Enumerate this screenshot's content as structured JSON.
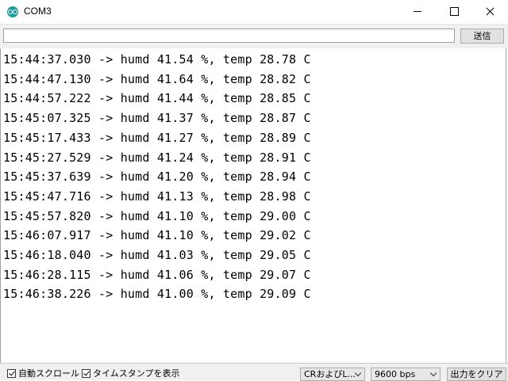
{
  "window": {
    "title": "COM3",
    "icon": "arduino-icon"
  },
  "send": {
    "input_value": "",
    "button_label": "送信"
  },
  "log": [
    "15:44:37.030 -> humd 41.54 %, temp 28.78 C",
    "15:44:47.130 -> humd 41.64 %, temp 28.82 C",
    "15:44:57.222 -> humd 41.44 %, temp 28.85 C",
    "15:45:07.325 -> humd 41.37 %, temp 28.87 C",
    "15:45:17.433 -> humd 41.27 %, temp 28.89 C",
    "15:45:27.529 -> humd 41.24 %, temp 28.91 C",
    "15:45:37.639 -> humd 41.20 %, temp 28.94 C",
    "15:45:47.716 -> humd 41.13 %, temp 28.98 C",
    "15:45:57.820 -> humd 41.10 %, temp 29.00 C",
    "15:46:07.917 -> humd 41.10 %, temp 29.02 C",
    "15:46:18.040 -> humd 41.03 %, temp 29.05 C",
    "15:46:28.115 -> humd 41.06 %, temp 29.07 C",
    "15:46:38.226 -> humd 41.00 %, temp 29.09 C"
  ],
  "statusbar": {
    "autoscroll_label": "自動スクロール",
    "autoscroll_checked": true,
    "timestamp_label": "タイムスタンプを表示",
    "timestamp_checked": true,
    "line_ending": "CRおよびL...",
    "baud_rate": "9600 bps",
    "clear_label": "出力をクリア"
  }
}
